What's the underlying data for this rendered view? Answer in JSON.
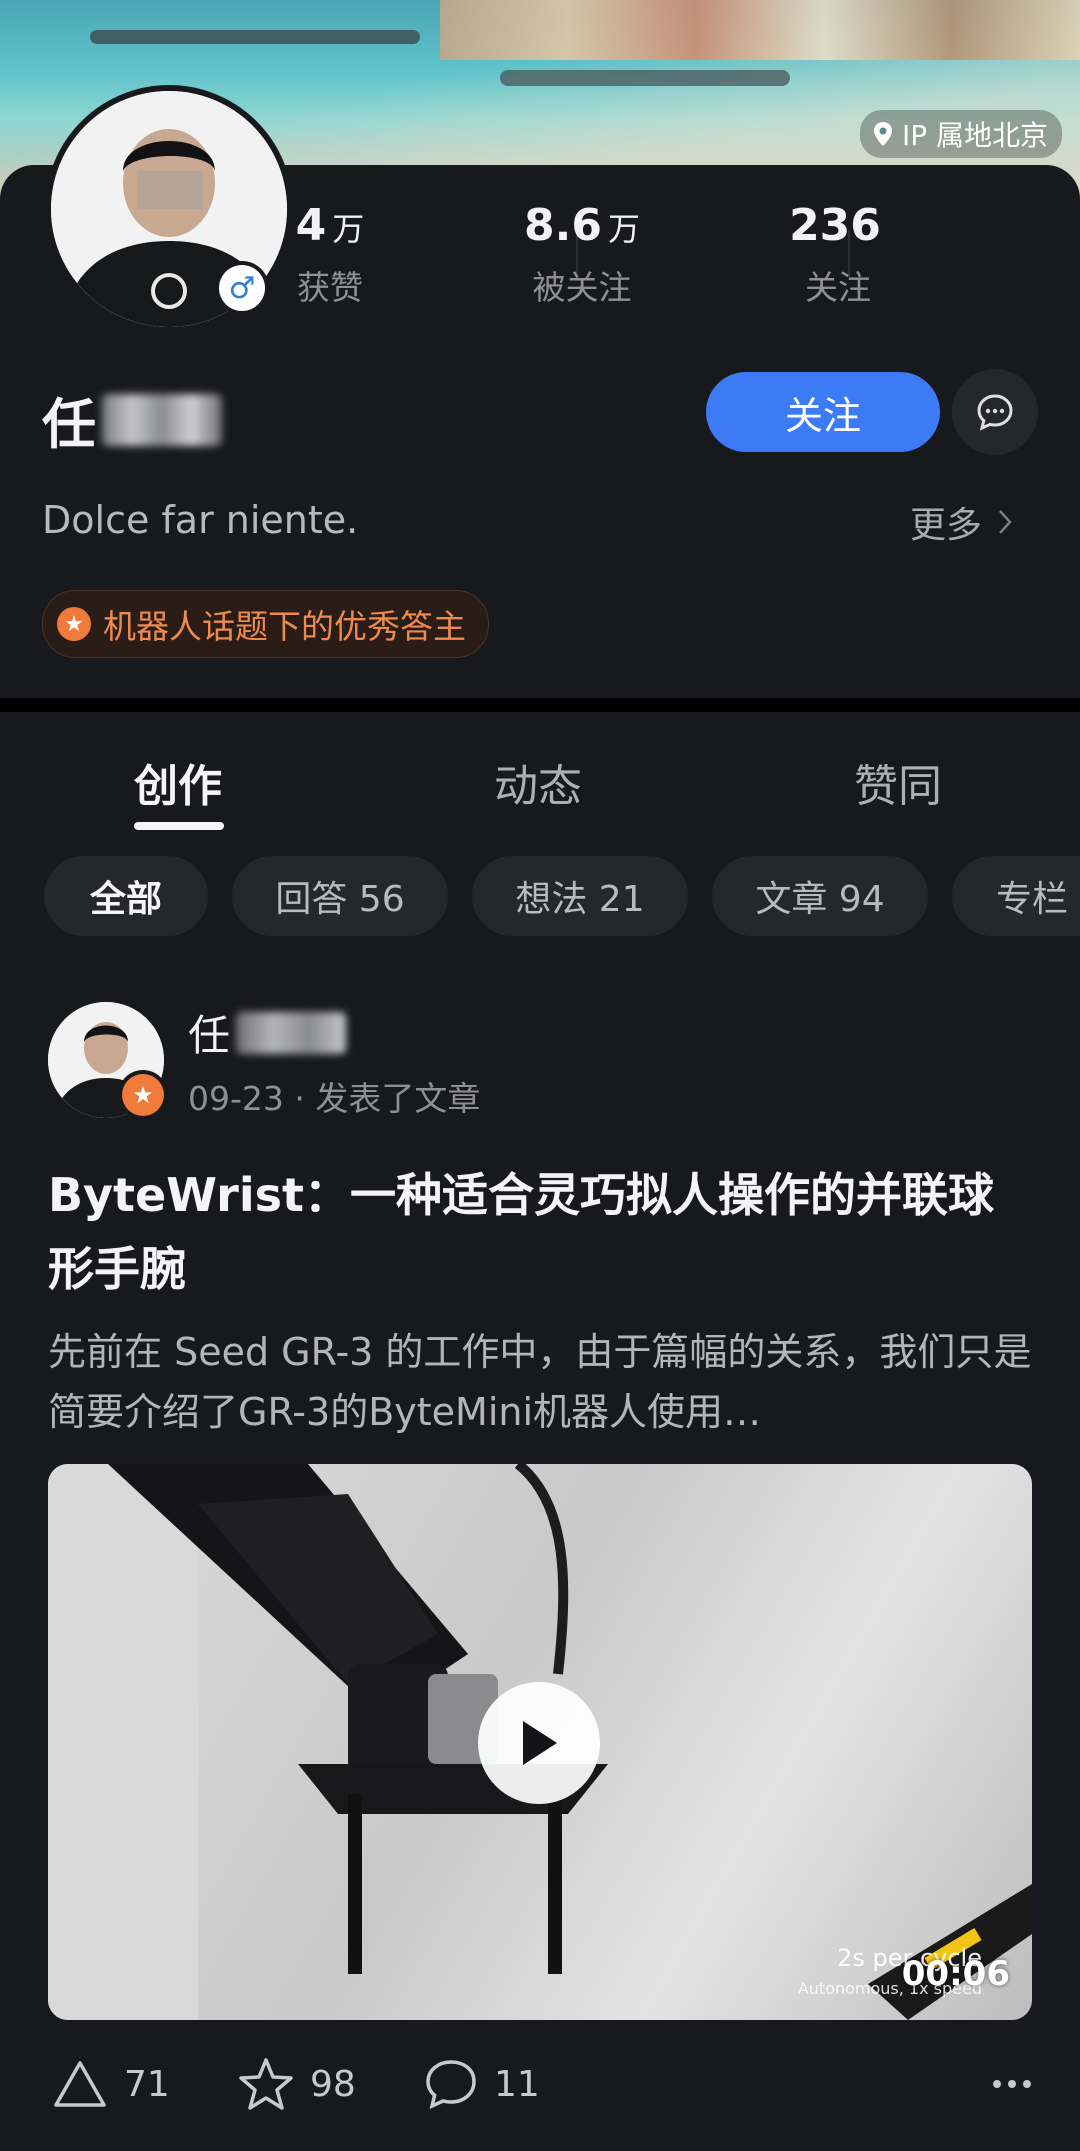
{
  "cover": {
    "ip_location": "IP 属地北京"
  },
  "profile": {
    "stats": [
      {
        "value": "4",
        "unit": "万",
        "label": "获赞"
      },
      {
        "value": "8.6",
        "unit": "万",
        "label": "被关注"
      },
      {
        "value": "236",
        "unit": "",
        "label": "关注"
      }
    ],
    "name": "任",
    "follow_label": "关注",
    "bio": "Dolce far niente.",
    "more_label": "更多",
    "badge": "机器人话题下的优秀答主"
  },
  "tabs": [
    "创作",
    "动态",
    "赞同"
  ],
  "filters": [
    "全部",
    "回答 56",
    "想法 21",
    "文章 94",
    "专栏"
  ],
  "post": {
    "author": "任",
    "meta": "09-23 · 发表了文章",
    "title": "ByteWrist：一种适合灵巧拟人操作的并联球形手腕",
    "excerpt": "先前在 Seed GR-3 的工作中，由于篇幅的关系，我们只是简要介绍了GR-3的ByteMini机器人使用…",
    "video": {
      "duration": "00:06",
      "caption_main": "2s per cycle",
      "caption_sub": "Autonomous, 1x speed"
    },
    "actions": {
      "likes": "71",
      "favorites": "98",
      "comments": "11"
    }
  },
  "colors": {
    "accent": "#3d7bf6",
    "badge": "#ef8a4e",
    "background": "#18191d"
  }
}
